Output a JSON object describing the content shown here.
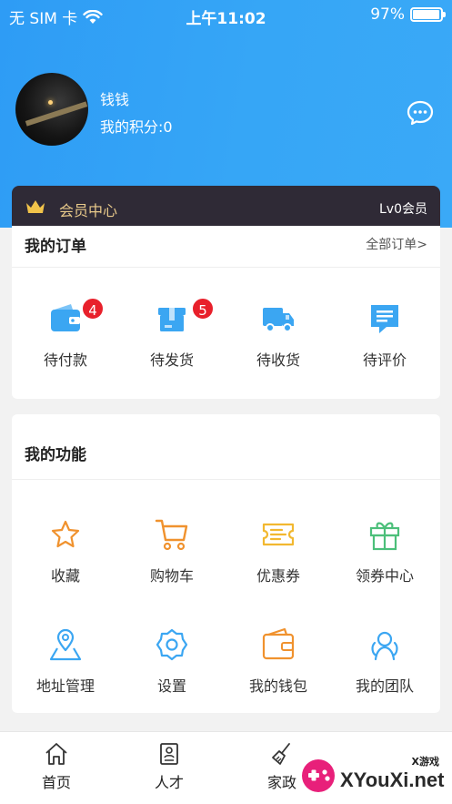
{
  "status_bar": {
    "carrier": "无 SIM 卡",
    "time": "上午11:02",
    "battery": "97%",
    "battery_level": 0.97
  },
  "profile": {
    "name": "钱钱",
    "points": "我的积分:0"
  },
  "member": {
    "label": "会员中心",
    "level": "Lv0会员"
  },
  "orders": {
    "title": "我的订单",
    "all_label": "全部订单>",
    "items": [
      {
        "label": "待付款",
        "icon": "wallet-icon",
        "badge": "4"
      },
      {
        "label": "待发货",
        "icon": "box-icon",
        "badge": "5"
      },
      {
        "label": "待收货",
        "icon": "truck-icon",
        "badge": ""
      },
      {
        "label": "待评价",
        "icon": "comment-icon",
        "badge": ""
      }
    ]
  },
  "functions": {
    "title": "我的功能",
    "items": [
      {
        "label": "收藏",
        "icon": "star-icon"
      },
      {
        "label": "购物车",
        "icon": "cart-icon"
      },
      {
        "label": "优惠券",
        "icon": "coupon-icon"
      },
      {
        "label": "领券中心",
        "icon": "gift-icon"
      },
      {
        "label": "地址管理",
        "icon": "location-icon"
      },
      {
        "label": "设置",
        "icon": "settings-icon"
      },
      {
        "label": "我的钱包",
        "icon": "wallet-icon"
      },
      {
        "label": "我的团队",
        "icon": "team-icon"
      }
    ]
  },
  "tabbar": {
    "items": [
      {
        "label": "首页",
        "icon": "home-icon"
      },
      {
        "label": "人才",
        "icon": "resume-icon"
      },
      {
        "label": "家政",
        "icon": "broom-icon"
      }
    ]
  },
  "watermark": {
    "text": "XYouXi.net",
    "small": "X游戏"
  },
  "colors": {
    "header": "#2e9cf5",
    "order_icon": "#3ba6f2",
    "badge": "#e8202b",
    "member_bg": "#2f2a36",
    "member_text": "#e8c98a",
    "func_orange": "#f0922e",
    "func_green": "#4cbf7a",
    "func_blue": "#3ba6f2"
  }
}
